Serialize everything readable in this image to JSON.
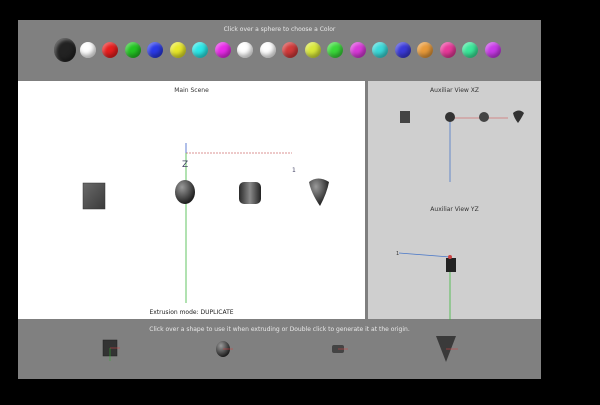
{
  "palette": {
    "title": "Click over a sphere to choose a Color",
    "colors": [
      "#222222",
      "#ffffff",
      "#e81e1e",
      "#22c522",
      "#2a3ae8",
      "#e8e82a",
      "#2ae8e8",
      "#e82ae8",
      "#ffffff",
      "#ffffff",
      "#d23a3a",
      "#d9e83a",
      "#3ad93a",
      "#d93ad9",
      "#3ad9d9",
      "#3a3ad9",
      "#e89a3a",
      "#e83a9a",
      "#3ae89a",
      "#c83ae8"
    ]
  },
  "main_scene": {
    "title": "Main Scene",
    "z_label": "Z",
    "x_label": "1",
    "mode_text": "Extrusion mode: DUPLICATE"
  },
  "aux_xz": {
    "title": "Auxiliar View XZ"
  },
  "aux_yz": {
    "title": "Auxiliar View YZ",
    "y_label": "1"
  },
  "shape_bar": {
    "title": "Click over a shape to use it when extruding or Double click to generate it at the origin."
  }
}
